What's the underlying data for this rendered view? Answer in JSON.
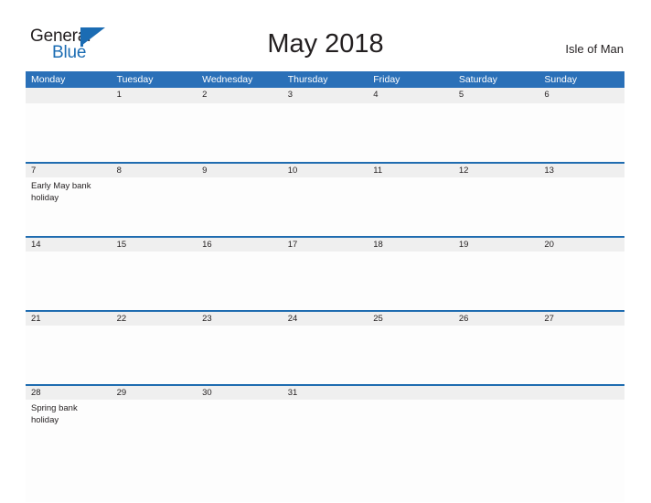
{
  "brand": {
    "name_part1": "General",
    "name_part2": "Blue",
    "triangle_color": "#1b6cb3",
    "text_color": "#231f20"
  },
  "header": {
    "title": "May 2018",
    "location": "Isle of Man"
  },
  "theme": {
    "header_blue": "#2a70b8",
    "rule_blue": "#1f6cb0",
    "date_band_gray": "#efefef",
    "page_background": "#ffffff",
    "text": "#231f20"
  },
  "calendar": {
    "month": "May",
    "year": "2018",
    "weekday_headers": [
      "Monday",
      "Tuesday",
      "Wednesday",
      "Thursday",
      "Friday",
      "Saturday",
      "Sunday"
    ],
    "weeks": [
      {
        "days": [
          {
            "date": "",
            "event": ""
          },
          {
            "date": "1",
            "event": ""
          },
          {
            "date": "2",
            "event": ""
          },
          {
            "date": "3",
            "event": ""
          },
          {
            "date": "4",
            "event": ""
          },
          {
            "date": "5",
            "event": ""
          },
          {
            "date": "6",
            "event": ""
          }
        ]
      },
      {
        "days": [
          {
            "date": "7",
            "event": "Early May bank holiday"
          },
          {
            "date": "8",
            "event": ""
          },
          {
            "date": "9",
            "event": ""
          },
          {
            "date": "10",
            "event": ""
          },
          {
            "date": "11",
            "event": ""
          },
          {
            "date": "12",
            "event": ""
          },
          {
            "date": "13",
            "event": ""
          }
        ]
      },
      {
        "days": [
          {
            "date": "14",
            "event": ""
          },
          {
            "date": "15",
            "event": ""
          },
          {
            "date": "16",
            "event": ""
          },
          {
            "date": "17",
            "event": ""
          },
          {
            "date": "18",
            "event": ""
          },
          {
            "date": "19",
            "event": ""
          },
          {
            "date": "20",
            "event": ""
          }
        ]
      },
      {
        "days": [
          {
            "date": "21",
            "event": ""
          },
          {
            "date": "22",
            "event": ""
          },
          {
            "date": "23",
            "event": ""
          },
          {
            "date": "24",
            "event": ""
          },
          {
            "date": "25",
            "event": ""
          },
          {
            "date": "26",
            "event": ""
          },
          {
            "date": "27",
            "event": ""
          }
        ]
      },
      {
        "days": [
          {
            "date": "28",
            "event": "Spring bank holiday"
          },
          {
            "date": "29",
            "event": ""
          },
          {
            "date": "30",
            "event": ""
          },
          {
            "date": "31",
            "event": ""
          },
          {
            "date": "",
            "event": ""
          },
          {
            "date": "",
            "event": ""
          },
          {
            "date": "",
            "event": ""
          }
        ]
      }
    ]
  }
}
